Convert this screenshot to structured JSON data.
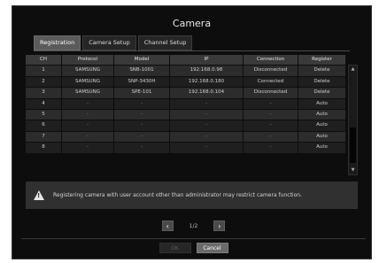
{
  "window": {
    "title": "Camera"
  },
  "tabs": [
    {
      "label": "Registration",
      "active": true
    },
    {
      "label": "Camera Setup",
      "active": false
    },
    {
      "label": "Channel Setup",
      "active": false
    }
  ],
  "table": {
    "columns": [
      "CH",
      "Protocol",
      "Model",
      "IP",
      "Connection",
      "Register"
    ],
    "rows": [
      [
        "1",
        "SAMSUNG",
        "SNB-1001",
        "192.168.0.98",
        "Disconnected",
        "Delete"
      ],
      [
        "2",
        "SAMSUNG",
        "SNP-3430H",
        "192.168.0.180",
        "Connected",
        "Delete"
      ],
      [
        "3",
        "SAMSUNG",
        "SPE-101",
        "192.168.0.104",
        "Disconnected",
        "Delete"
      ],
      [
        "4",
        "-",
        "-",
        "-",
        "-",
        "Auto"
      ],
      [
        "5",
        "-",
        "-",
        "-",
        "-",
        "Auto"
      ],
      [
        "6",
        "-",
        "-",
        "-",
        "-",
        "Auto"
      ],
      [
        "7",
        "-",
        "-",
        "-",
        "-",
        "Auto"
      ],
      [
        "8",
        "-",
        "-",
        "-",
        "-",
        "Auto"
      ]
    ]
  },
  "warning": {
    "icon": "warning-triangle-icon",
    "text": "Registering camera with user account other than administrator may restrict camera function."
  },
  "pagination": {
    "prev": "‹",
    "page": "1/2",
    "next": "›"
  },
  "buttons": {
    "ok": "OK",
    "cancel": "Cancel"
  }
}
